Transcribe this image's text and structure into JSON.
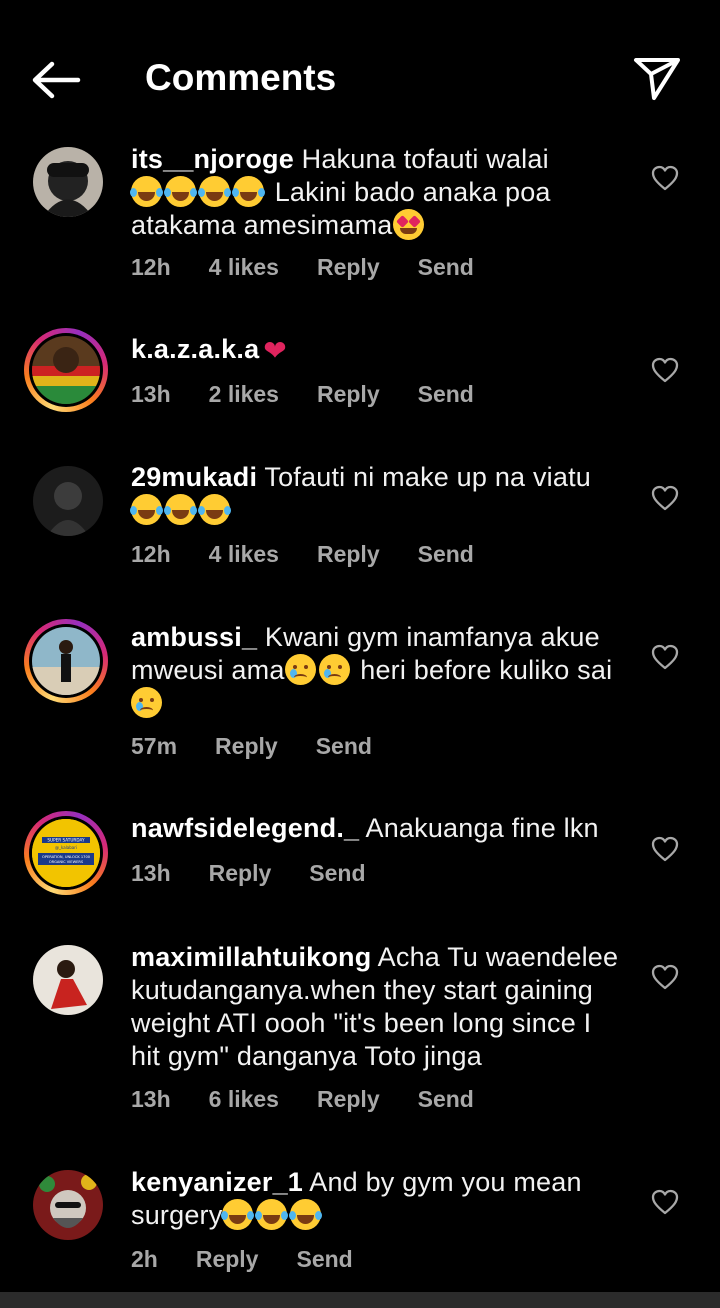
{
  "header": {
    "title": "Comments"
  },
  "comments": [
    {
      "user": "its__njoroge",
      "text1": "Hakuna  tofauti  walai",
      "text2": " Lakini  bado  anaka  poa",
      "text3": "atakama  amesimama",
      "time": "12h",
      "likes": "4 likes",
      "reply": "Reply",
      "send": "Send"
    },
    {
      "user": "k.a.z.a.k.a",
      "time": "13h",
      "likes": "2 likes",
      "reply": "Reply",
      "send": "Send"
    },
    {
      "user": "29mukadi",
      "text1": "Tofauti ni make up na viatu",
      "time": "12h",
      "likes": "4 likes",
      "reply": "Reply",
      "send": "Send"
    },
    {
      "user": "ambussi_",
      "text1": "Kwani gym inamfanya akue",
      "text2": "mweusi ama",
      "text3": " heri before kuliko sai",
      "time": "57m",
      "reply": "Reply",
      "send": "Send"
    },
    {
      "user": "nawfsidelegend._",
      "text1": "Anakuanga fine lkn",
      "time": "13h",
      "reply": "Reply",
      "send": "Send",
      "avatar_text": {
        "l1": "SUPER SATURDAY",
        "l2": "@_kalabari",
        "l3": "OPERATION, UNLOCK 1700",
        "l4": "ORGANIC VIEWERS"
      }
    },
    {
      "user": "maximillahtuikong",
      "text1": "Acha Tu waendelee",
      "text2": "kutudanganya.when they start gaining",
      "text3": "weight ATI oooh \"it's been long since I",
      "text4": "hit gym\" danganya Toto jinga",
      "time": "13h",
      "likes": "6 likes",
      "reply": "Reply",
      "send": "Send"
    },
    {
      "user": "kenyanizer_1",
      "text1": "And by gym you mean",
      "text2": "surgery",
      "time": "2h",
      "reply": "Reply",
      "send": "Send"
    }
  ],
  "colors": {
    "background": "#000000",
    "meta": "#a8a8a8",
    "story_ring": "#d62976",
    "heart": "#e0245e"
  },
  "icons": {
    "back": "arrow-left-icon",
    "send": "paper-plane-icon",
    "like": "heart-outline-icon"
  }
}
